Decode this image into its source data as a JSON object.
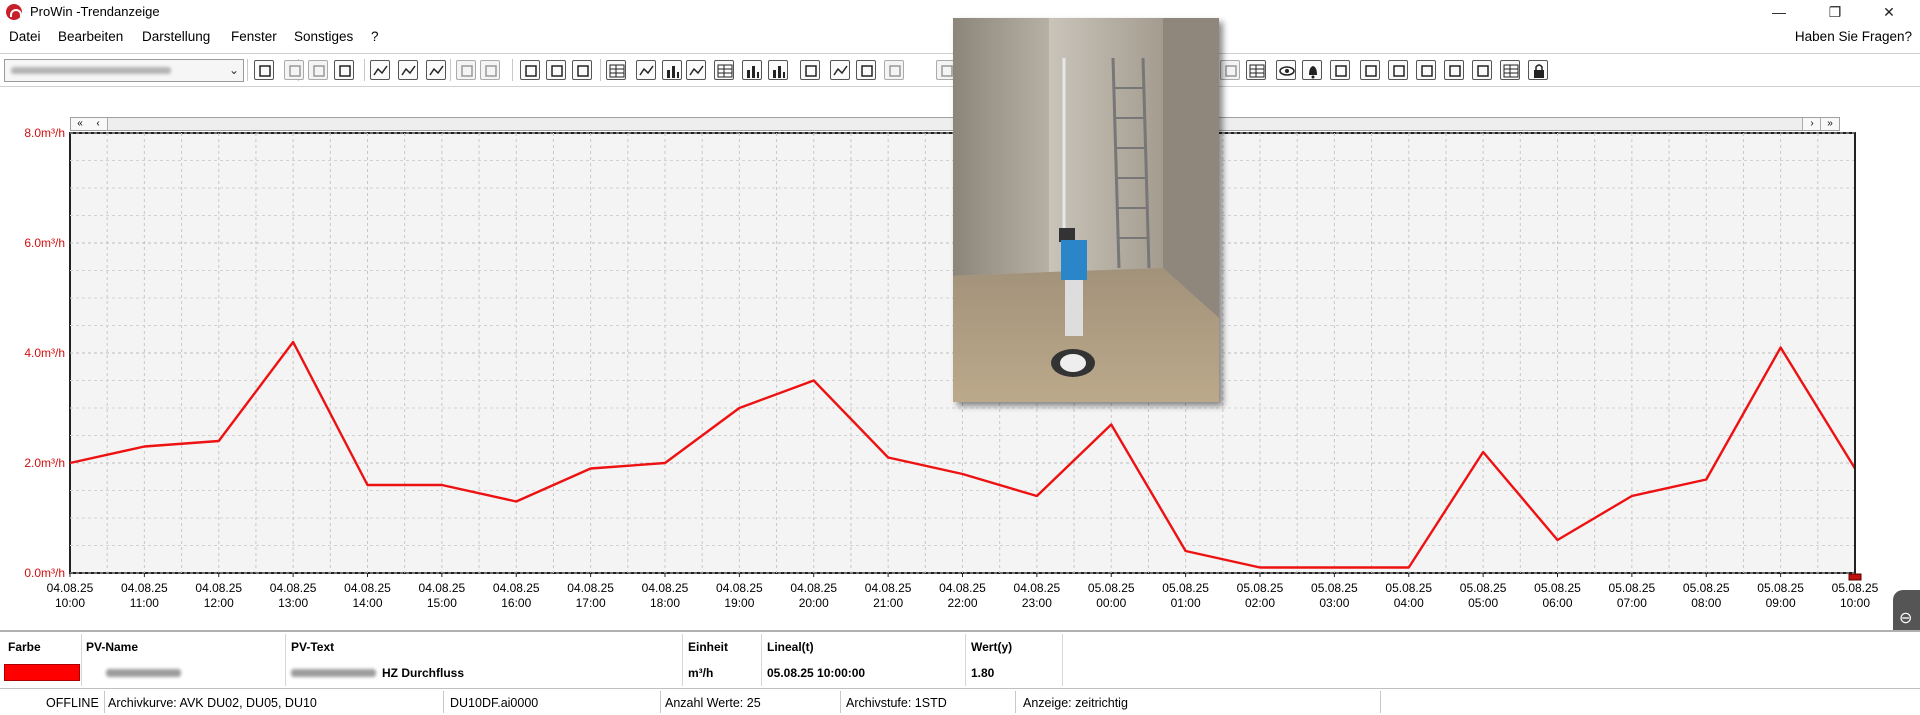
{
  "window": {
    "title": "ProWin -Trendanzeige",
    "minimize": "—",
    "restore": "❐",
    "close": "✕"
  },
  "menu": {
    "items": [
      "Datei",
      "Bearbeiten",
      "Darstellung",
      "Fenster",
      "Sonstiges",
      "?"
    ],
    "help": "Haben Sie Fragen?"
  },
  "toolbar": {
    "icons": [
      "refresh-icon",
      "cut-icon",
      "copy-icon",
      "paste-icon",
      "trend-icon",
      "trend-area-icon",
      "trend-fill-icon",
      "copy-dim-icon",
      "paste-dim-icon",
      "save-icon",
      "print-icon",
      "print-preview-icon",
      "table-icon",
      "curve-icon",
      "bar-icon",
      "wave-icon",
      "grid-icon",
      "columns-icon",
      "bars-icon",
      "fit-icon",
      "zoom-curve-icon",
      "zoom-area-icon",
      "windows-icon",
      "cursor-icon",
      "arrow-icon",
      "list-icon",
      "eye-icon",
      "bell-icon",
      "network-icon",
      "image-icon",
      "database-icon",
      "hand-icon",
      "antenna-icon",
      "edit-icon",
      "calendar-icon",
      "lock-icon"
    ]
  },
  "chart_data": {
    "type": "line",
    "y_ticks": [
      "8.0m³/h",
      "6.0m³/h",
      "4.0m³/h",
      "2.0m³/h",
      "0.0m³/h"
    ],
    "ylim": [
      0,
      8
    ],
    "x_labels": [
      [
        "04.08.25",
        "10:00"
      ],
      [
        "04.08.25",
        "11:00"
      ],
      [
        "04.08.25",
        "12:00"
      ],
      [
        "04.08.25",
        "13:00"
      ],
      [
        "04.08.25",
        "14:00"
      ],
      [
        "04.08.25",
        "15:00"
      ],
      [
        "04.08.25",
        "16:00"
      ],
      [
        "04.08.25",
        "17:00"
      ],
      [
        "04.08.25",
        "18:00"
      ],
      [
        "04.08.25",
        "19:00"
      ],
      [
        "04.08.25",
        "20:00"
      ],
      [
        "04.08.25",
        "21:00"
      ],
      [
        "04.08.25",
        "22:00"
      ],
      [
        "04.08.25",
        "23:00"
      ],
      [
        "05.08.25",
        "00:00"
      ],
      [
        "05.08.25",
        "01:00"
      ],
      [
        "05.08.25",
        "02:00"
      ],
      [
        "05.08.25",
        "03:00"
      ],
      [
        "05.08.25",
        "04:00"
      ],
      [
        "05.08.25",
        "05:00"
      ],
      [
        "05.08.25",
        "06:00"
      ],
      [
        "05.08.25",
        "07:00"
      ],
      [
        "05.08.25",
        "08:00"
      ],
      [
        "05.08.25",
        "09:00"
      ],
      [
        "05.08.25",
        "10:00"
      ]
    ],
    "series": [
      {
        "color": "#ee1111",
        "values": [
          2.0,
          2.3,
          2.4,
          4.2,
          1.6,
          1.6,
          1.3,
          1.9,
          2.0,
          3.0,
          3.5,
          2.1,
          1.8,
          1.4,
          2.7,
          0.4,
          0.1,
          0.1,
          0.1,
          2.2,
          0.6,
          1.4,
          1.7,
          4.1,
          1.9
        ]
      }
    ],
    "grid": true
  },
  "legend": {
    "headers": {
      "color": "Farbe",
      "name": "PV-Name",
      "text": "PV-Text",
      "unit": "Einheit",
      "ruler": "Lineal(t)",
      "value": "Wert(y)"
    },
    "row": {
      "text": "HZ Durchfluss",
      "unit": "m³/h",
      "ruler": "05.08.25 10:00:00",
      "value": "1.80",
      "color": "#ff0000"
    }
  },
  "status": {
    "mode": "OFFLINE",
    "curve": "Archivkurve:  AVK DU02, DU05, DU10",
    "id": "DU10DF.ai0000",
    "count": "Anzahl Werte:  25",
    "stage": "Archivstufe:  1STD",
    "display": "Anzeige:  zeitrichtig"
  }
}
